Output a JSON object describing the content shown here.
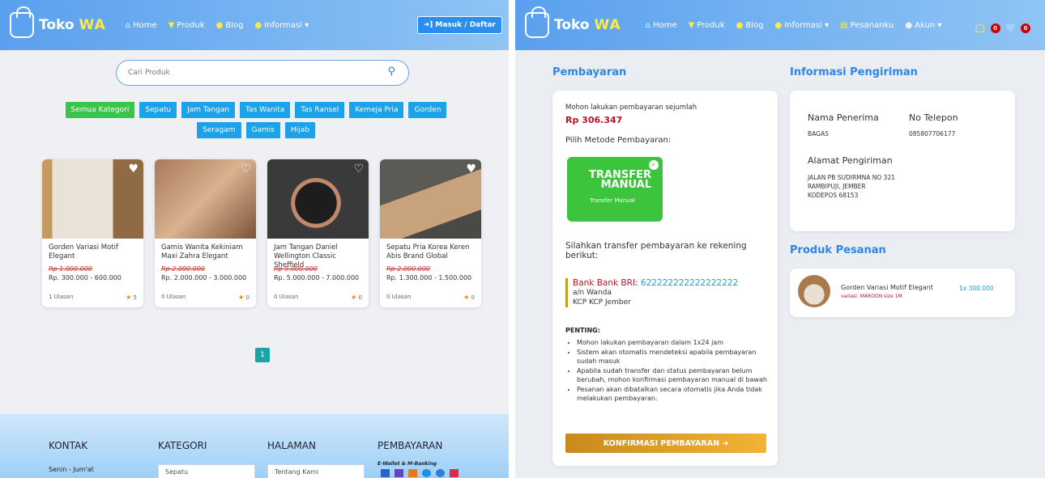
{
  "left": {
    "brand": {
      "name": "Toko",
      "suffix": "WA"
    },
    "nav": [
      {
        "icon": "home-icon",
        "glyph": "⌂",
        "label": "Home"
      },
      {
        "icon": "cart-icon",
        "glyph": "▼",
        "label": "Produk"
      },
      {
        "icon": "blog-icon",
        "glyph": "●",
        "label": "Blog"
      },
      {
        "icon": "info-icon",
        "glyph": "●",
        "label": "Informasi ▾"
      }
    ],
    "login_label": "➜] Masuk / Daftar",
    "search": {
      "placeholder": "Cari Produk"
    },
    "categories": [
      "Semua Kategori",
      "Sepatu",
      "Jam Tangan",
      "Tas Wanita",
      "Tas Ransel",
      "Kemeja Pria",
      "Gorden",
      "Seragam",
      "Gamis",
      "Hijab"
    ],
    "products": [
      {
        "name": "Gorden Variasi Motif Elegant",
        "old_price": "Rp 1.000.000",
        "price": "Rp. 300.000 - 600.000",
        "reviews": "1 Ulasan",
        "rating": "5"
      },
      {
        "name": "Gamis Wanita Kekiniam Maxi Zahra Elegant",
        "old_price": "Rp 2.000.000",
        "price": "Rp. 2.000.000 - 3.000.000",
        "reviews": "0 Ulasan",
        "rating": "0"
      },
      {
        "name": "Jam Tangan Daniel Wellington Classic Sheffield",
        "old_price": "Rp 9.000.000",
        "price": "Rp. 5.000.000 - 7.000.000",
        "reviews": "0 Ulasan",
        "rating": "0"
      },
      {
        "name": "Sepatu Pria Korea Keren Abis Brand Global",
        "old_price": "Rp 2.000.000",
        "price": "Rp. 1.300.000 - 1.500.000",
        "reviews": "0 Ulasan",
        "rating": "0"
      }
    ],
    "page": "1",
    "footer": {
      "kontak": "KONTAK",
      "kontak_sub": "Senin - Jum'at",
      "kategori": "KATEGORI",
      "kategori_item": "Sepatu",
      "halaman": "HALAMAN",
      "halaman_item": "Tentang Kami",
      "pembayaran": "PEMBAYARAN",
      "pembayaran_sub": "E-Wallet & M-Banking"
    }
  },
  "right": {
    "brand": {
      "name": "Toko",
      "suffix": "WA"
    },
    "nav": [
      {
        "icon": "home-icon",
        "glyph": "⌂",
        "label": "Home"
      },
      {
        "icon": "cart-icon",
        "glyph": "▼",
        "label": "Produk"
      },
      {
        "icon": "blog-icon",
        "glyph": "●",
        "label": "Blog"
      },
      {
        "icon": "info-icon",
        "glyph": "●",
        "label": "Informasi ▾"
      },
      {
        "icon": "orders-icon",
        "glyph": "▤",
        "label": "Pesananku"
      },
      {
        "icon": "account-icon",
        "glyph": "●",
        "label": "Akun ▾"
      }
    ],
    "cart_count": "0",
    "wish_count": "0",
    "payment": {
      "heading": "Pembayaran",
      "prompt": "Mohon lakukan pembayaran sejumlah",
      "amount": "Rp 306.347",
      "method_prompt": "Pilih Metode Pembayaran:",
      "method_title": "TRANSFER MANUAL",
      "method_caption": "Transfer Manual",
      "transfer_prompt": "Silahkan transfer pembayaran ke rekening berikut:",
      "bank_name": "Bank Bank BRI:",
      "bank_account": "622222222222222222",
      "bank_owner": "a/n Wanda",
      "bank_branch": "KCP KCP Jember",
      "important_label": "PENTING:",
      "notes": [
        "Mohon lakukan pembayaran dalam 1x24 jam",
        "Sistem akan otomatis mendeteksi apabila pembayaran sudah masuk",
        "Apabila sudah transfer dan status pembayaran belum berubah, mohon konfirmasi pembayaran manual di bawah",
        "Pesanan akan dibatalkan secara otomatis jika Anda tidak melakukan pembayaran."
      ],
      "confirm_label": "KONFIRMASI PEMBAYARAN ➔"
    },
    "shipping": {
      "heading": "Informasi Pengiriman",
      "recipient_label": "Nama Penerima",
      "recipient": "BAGAS",
      "phone_label": "No Telepon",
      "phone": "085807706177",
      "address_label": "Alamat Pengiriman",
      "address": [
        "JALAN PB SUDIRMNA NO 321",
        "RAMBIPUJI, JEMBER",
        "KODEPOS 68153"
      ]
    },
    "order": {
      "heading": "Produk Pesanan",
      "item_name": "Gorden Variasi Motif Elegant",
      "item_variant": "variasi: MAROON size 1M",
      "item_qty": "1x 300.000"
    }
  }
}
